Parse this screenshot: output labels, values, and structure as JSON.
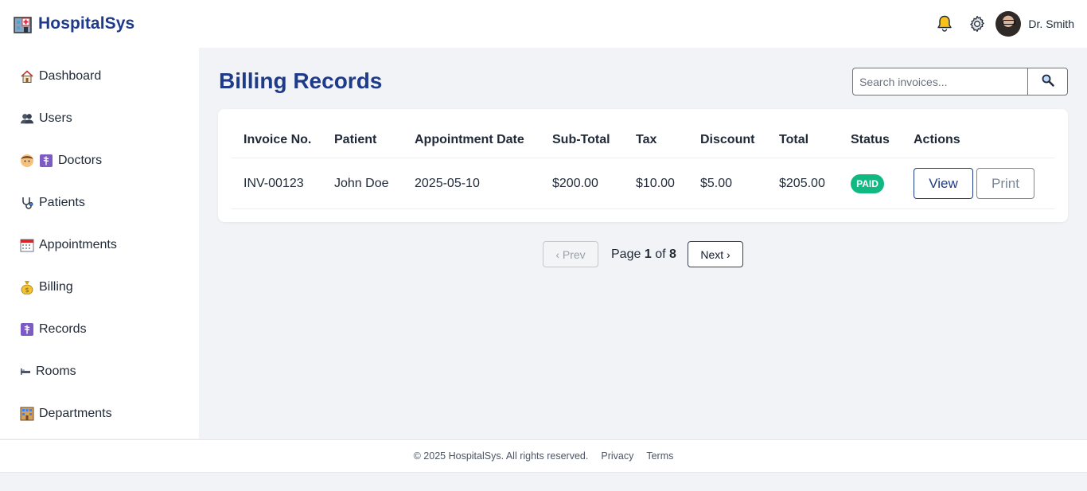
{
  "app": {
    "name": "HospitalSys"
  },
  "header": {
    "user_name": "Dr. Smith"
  },
  "sidebar": {
    "items": [
      {
        "label": "Dashboard",
        "icon": "house-icon"
      },
      {
        "label": "Users",
        "icon": "users-icon"
      },
      {
        "label": "Doctors",
        "icon": "doctor-icon"
      },
      {
        "label": "Patients",
        "icon": "stethoscope-icon"
      },
      {
        "label": "Appointments",
        "icon": "calendar-icon"
      },
      {
        "label": "Billing",
        "icon": "money-bag-icon"
      },
      {
        "label": "Records",
        "icon": "medical-record-icon"
      },
      {
        "label": "Rooms",
        "icon": "bed-icon"
      },
      {
        "label": "Departments",
        "icon": "hospital-icon"
      }
    ]
  },
  "main": {
    "title": "Billing Records",
    "search": {
      "placeholder": "Search invoices...",
      "value": ""
    },
    "table": {
      "columns": [
        "Invoice No.",
        "Patient",
        "Appointment Date",
        "Sub-Total",
        "Tax",
        "Discount",
        "Total",
        "Status",
        "Actions"
      ],
      "rows": [
        {
          "invoice_no": "INV-00123",
          "patient": "John Doe",
          "appointment_date": "2025-05-10",
          "sub_total": "$200.00",
          "tax": "$10.00",
          "discount": "$5.00",
          "total": "$205.00",
          "status": "PAID",
          "actions": [
            "View",
            "Print"
          ]
        }
      ]
    },
    "pagination": {
      "prev_label": "‹ Prev",
      "next_label": "Next ›",
      "page_word": "Page",
      "of_word": "of",
      "current": "1",
      "total": "8"
    }
  },
  "footer": {
    "copyright": "© 2025 HospitalSys. All rights reserved.",
    "links": [
      "Privacy",
      "Terms"
    ]
  },
  "colors": {
    "brand": "#1e3a8a",
    "paid_badge": "#10b981",
    "background": "#f2f3f6"
  }
}
